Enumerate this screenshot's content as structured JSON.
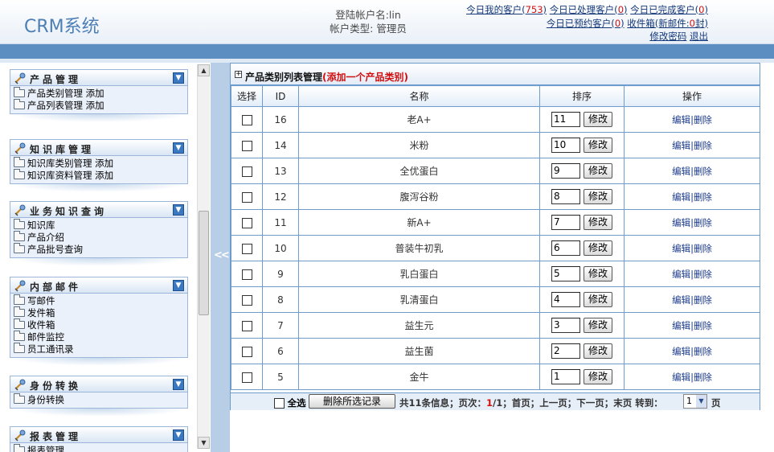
{
  "header": {
    "logo": "CRM系统",
    "login_label": "登陆帐户名:lin",
    "account_type": "帐户类型: 管理员",
    "links": {
      "my_customers": "今日我的客户(",
      "my_customers_count": "753",
      "handled": "今日已处理客户(",
      "handled_count": "0",
      "completed": "今日已完成客户(",
      "completed_count": "0",
      "reserved": "今日已预约客户(",
      "reserved_count": "0",
      "inbox": "收件箱(新邮件:",
      "inbox_count": "0",
      "inbox_suffix": "封)",
      "change_password": "修改密码",
      "logout": "退出",
      "close_paren": ")"
    }
  },
  "sidebar": {
    "sections": [
      {
        "title": "产品管理",
        "items": [
          "产品类别管理 添加",
          "产品列表管理 添加"
        ]
      },
      {
        "title": "知识库管理",
        "items": [
          "知识库类别管理 添加",
          "知识库资料管理 添加"
        ]
      },
      {
        "title": "业务知识查询",
        "items": [
          "知识库",
          "产品介绍",
          "产品批号查询"
        ]
      },
      {
        "title": "内部邮件",
        "items": [
          "写邮件",
          "发件箱",
          "收件箱",
          "邮件监控",
          "员工通讯录"
        ]
      },
      {
        "title": "身份转换",
        "items": [
          "身份转换"
        ]
      },
      {
        "title": "报表管理",
        "items": [
          "报表管理"
        ]
      }
    ],
    "collapse_symbol": "<<"
  },
  "panel": {
    "title": "产品类别列表管理",
    "add_link": "(添加一个产品类别)",
    "columns": [
      "选择",
      "ID",
      "名称",
      "排序",
      "操作"
    ],
    "modify_label": "修改",
    "edit_label": "编辑",
    "delete_label": "删除",
    "rows": [
      {
        "id": "16",
        "name": "老A+",
        "sort": "11"
      },
      {
        "id": "14",
        "name": "米粉",
        "sort": "10"
      },
      {
        "id": "13",
        "name": "全优蛋白",
        "sort": "9"
      },
      {
        "id": "12",
        "name": "腹泻谷粉",
        "sort": "8"
      },
      {
        "id": "11",
        "name": "新A+",
        "sort": "7"
      },
      {
        "id": "10",
        "name": "普装牛初乳",
        "sort": "6"
      },
      {
        "id": "9",
        "name": "乳白蛋白",
        "sort": "5"
      },
      {
        "id": "8",
        "name": "乳清蛋白",
        "sort": "4"
      },
      {
        "id": "7",
        "name": "益生元",
        "sort": "3"
      },
      {
        "id": "6",
        "name": "益生菌",
        "sort": "2"
      },
      {
        "id": "5",
        "name": "金牛",
        "sort": "1"
      }
    ]
  },
  "pager": {
    "select_all": "全选",
    "delete_selected": "删除所选记录",
    "info_prefix": "共11条信息；页次：",
    "current_page": "1",
    "total_pages": "/1",
    "nav": "；首页；上一页；下一页；末页  转到：",
    "goto_value": "1",
    "page_word": "页"
  }
}
